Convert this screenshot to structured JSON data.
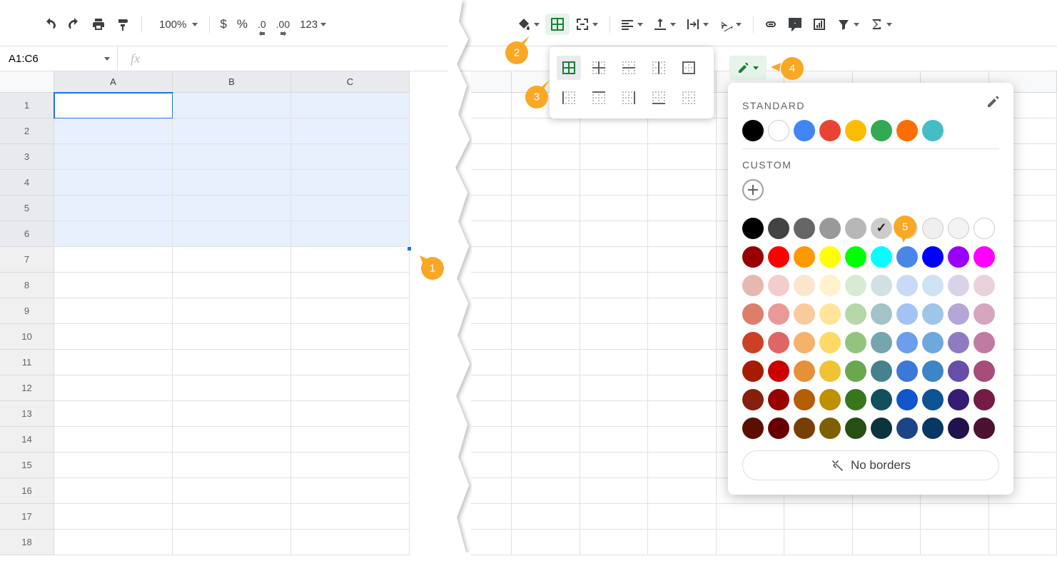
{
  "toolbar": {
    "zoom": "100%",
    "currency": "$",
    "percent": "%",
    "dec_dec": ".0",
    "dec_inc": ".00",
    "more_formats": "123"
  },
  "namebox": "A1:C6",
  "fx_label": "fx",
  "columns": [
    "A",
    "B",
    "C"
  ],
  "rows": [
    "1",
    "2",
    "3",
    "4",
    "5",
    "6",
    "7",
    "8",
    "9",
    "10",
    "11",
    "12",
    "13",
    "14",
    "15",
    "16",
    "17",
    "18"
  ],
  "right_columns": [
    "",
    "",
    "",
    "",
    "",
    "",
    "",
    ""
  ],
  "color_panel": {
    "standard_label": "STANDARD",
    "custom_label": "CUSTOM",
    "no_borders": "No borders",
    "standard": [
      "#000000",
      "#ffffff",
      "#4285f4",
      "#ea4335",
      "#fbbc04",
      "#34a853",
      "#ff6d01",
      "#46bdc6"
    ],
    "greys": [
      "#000000",
      "#434343",
      "#666666",
      "#999999",
      "#b7b7b7",
      "#cccccc",
      "#d9d9d9",
      "#efefef",
      "#f3f3f3",
      "#ffffff"
    ],
    "palette": [
      [
        "#980000",
        "#ff0000",
        "#ff9900",
        "#ffff00",
        "#00ff00",
        "#00ffff",
        "#4a86e8",
        "#0000ff",
        "#9900ff",
        "#ff00ff"
      ],
      [
        "#e6b8af",
        "#f4cccc",
        "#fce5cd",
        "#fff2cc",
        "#d9ead3",
        "#d0e0e3",
        "#c9daf8",
        "#cfe2f3",
        "#d9d2e9",
        "#ead1dc"
      ],
      [
        "#dd7e6b",
        "#ea9999",
        "#f9cb9c",
        "#ffe599",
        "#b6d7a8",
        "#a2c4c9",
        "#a4c2f4",
        "#9fc5e8",
        "#b4a7d6",
        "#d5a6bd"
      ],
      [
        "#cc4125",
        "#e06666",
        "#f6b26b",
        "#ffd966",
        "#93c47d",
        "#76a5af",
        "#6d9eeb",
        "#6fa8dc",
        "#8e7cc3",
        "#c27ba0"
      ],
      [
        "#a61c00",
        "#cc0000",
        "#e69138",
        "#f1c232",
        "#6aa84f",
        "#45818e",
        "#3c78d8",
        "#3d85c6",
        "#674ea7",
        "#a64d79"
      ],
      [
        "#85200c",
        "#990000",
        "#b45f06",
        "#bf9000",
        "#38761d",
        "#134f5c",
        "#1155cc",
        "#0b5394",
        "#351c75",
        "#741b47"
      ],
      [
        "#5b0f00",
        "#660000",
        "#783f04",
        "#7f6000",
        "#274e13",
        "#0c343d",
        "#1c4587",
        "#073763",
        "#20124d",
        "#4c1130"
      ]
    ]
  },
  "callouts": {
    "c1": "1",
    "c2": "2",
    "c3": "3",
    "c4": "4",
    "c5": "5"
  }
}
